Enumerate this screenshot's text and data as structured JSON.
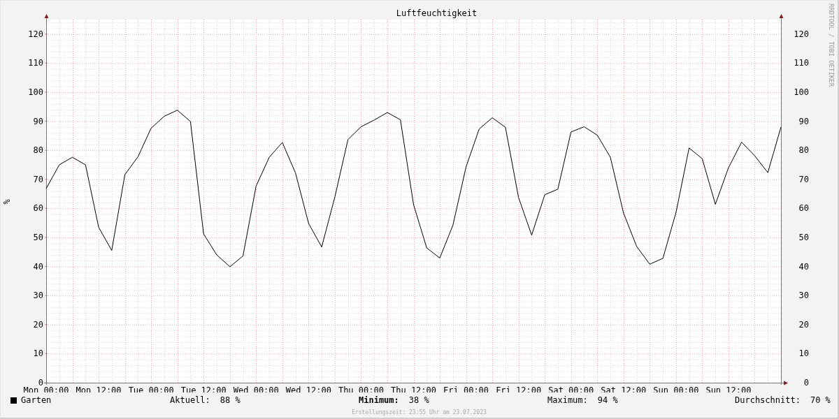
{
  "chart": {
    "chart_data": {
      "type": "line",
      "title": "Luftfeuchtigkeit",
      "ylabel": "%",
      "categories": [
        "Mon 00:00",
        null,
        null,
        null,
        "Mon 12:00",
        null,
        null,
        null,
        "Tue 00:00",
        null,
        null,
        null,
        "Tue 12:00",
        null,
        null,
        null,
        "Wed 00:00",
        null,
        null,
        null,
        "Wed 12:00",
        null,
        null,
        null,
        "Thu 00:00",
        null,
        null,
        null,
        "Thu 12:00",
        null,
        null,
        null,
        "Fri 00:00",
        null,
        null,
        null,
        "Fri 12:00",
        null,
        null,
        null,
        "Sat 00:00",
        null,
        null,
        null,
        "Sat 12:00",
        null,
        null,
        null,
        "Sun 00:00",
        null,
        null,
        null,
        "Sun 12:00",
        null,
        null,
        null,
        null
      ],
      "series": [
        {
          "name": "Garten",
          "color": "#000000",
          "values": [
            66.8,
            75,
            77.6,
            75,
            53.5,
            45.5,
            71.6,
            77.8,
            87.6,
            91.7,
            93.8,
            89.9,
            51.2,
            44,
            39.9,
            43.6,
            67.7,
            77.6,
            82.7,
            72.2,
            54.8,
            46.7,
            63.9,
            83.7,
            88.1,
            90.4,
            93,
            90.5,
            61.3,
            46.4,
            42.9,
            54.2,
            74.3,
            87.3,
            91.2,
            87.9,
            63.8,
            50.8,
            64.7,
            66.6,
            86.3,
            88.1,
            85.2,
            77.6,
            58.4,
            46.9,
            40.8,
            42.8,
            58.6,
            80.8,
            77.1,
            61.4,
            74,
            82.8,
            78.1,
            72.3,
            88
          ]
        }
      ],
      "ylim": [
        0,
        125
      ],
      "grid": true,
      "yticks": [
        0,
        10,
        20,
        30,
        40,
        50,
        60,
        70,
        80,
        90,
        100,
        110,
        120
      ]
    }
  },
  "right_axis": {
    "ticks": [
      "120",
      "110",
      "100",
      "90",
      "80",
      "70",
      "60",
      "50",
      "40",
      "30",
      "20",
      "10",
      "0"
    ]
  },
  "credit": "RRDTOOL / TOBI OETIKER",
  "legend": {
    "stats": [
      {
        "label": "Aktuell:",
        "value": "88 %",
        "bold": false
      },
      {
        "label": "Minimum:",
        "value": "38 %",
        "bold": true
      },
      {
        "label": "Maximum:",
        "value": "94 %",
        "bold": false
      },
      {
        "label": "Durchschnitt:",
        "value": "70 %",
        "bold": false
      }
    ]
  },
  "footer": "Erstellungszeit: 23:55 Uhr am 23.07.2023"
}
